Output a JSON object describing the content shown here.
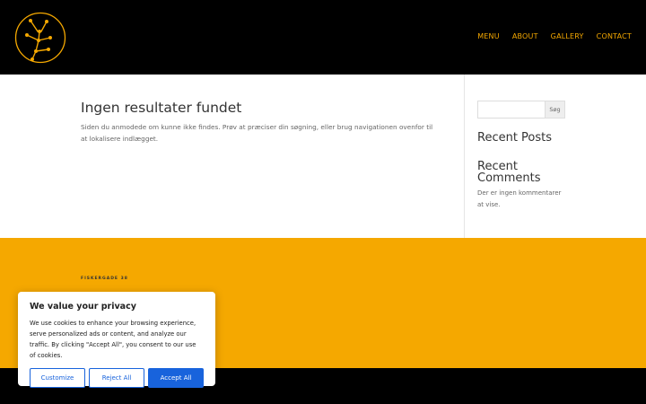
{
  "nav": {
    "items": [
      "MENU",
      "ABOUT",
      "GALLERY",
      "CONTACT"
    ]
  },
  "colors": {
    "accent": "#f5a800",
    "header_bg": "#000000",
    "cookie_button": "#1863dc"
  },
  "logo": {
    "icon": "constellation-logo-icon"
  },
  "main": {
    "title": "Ingen resultater fundet",
    "body": "Siden du anmodede om kunne ikke findes. Prøv at præciser din søgning, eller brug navigationen ovenfor til at lokalisere indlægget."
  },
  "sidebar": {
    "search_placeholder": "",
    "search_button": "Søg",
    "recent_posts_title": "Recent Posts",
    "recent_comments_title": "Recent Comments",
    "recent_comments_text": "Der er ingen kommentarer at vise."
  },
  "footer": {
    "address": "FISKERGADE 38"
  },
  "cookie": {
    "title": "We value your privacy",
    "text": "We use cookies to enhance your browsing experience, serve personalized ads or content, and analyze our traffic. By clicking \"Accept All\", you consent to our use of cookies.",
    "customize": "Customize",
    "reject": "Reject All",
    "accept": "Accept All"
  }
}
